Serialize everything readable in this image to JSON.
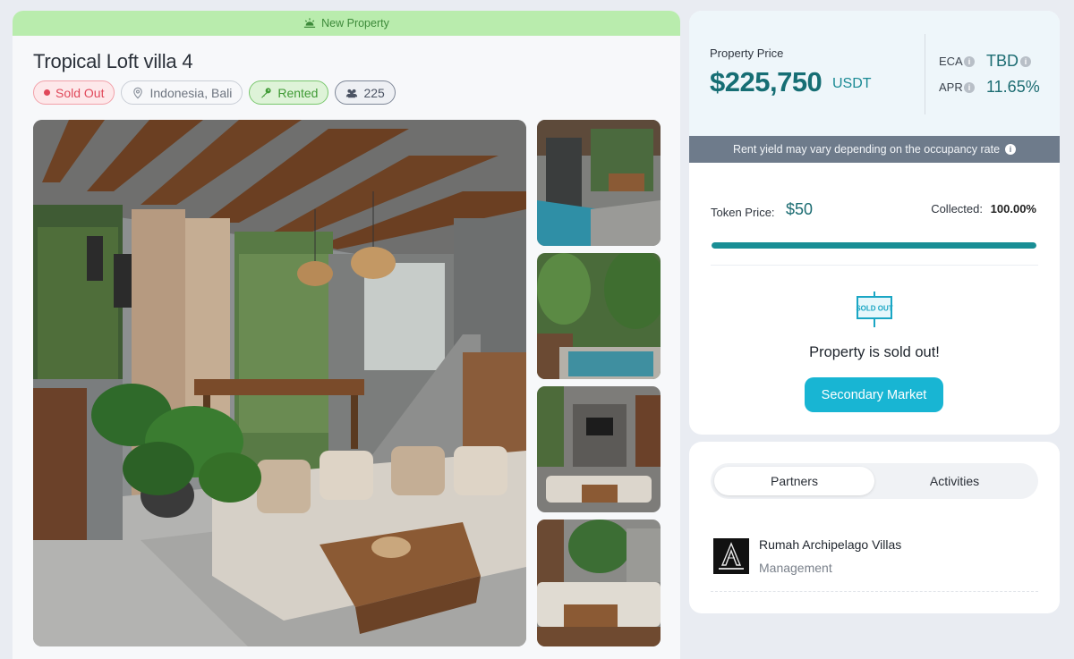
{
  "banner": {
    "label": "New Property"
  },
  "property": {
    "title": "Tropical Loft villa 4",
    "status": "Sold Out",
    "location": "Indonesia, Bali",
    "rental_status": "Rented",
    "investors": "225"
  },
  "pricing": {
    "label": "Property Price",
    "value": "$225,750",
    "unit": "USDT",
    "eca_label": "ECA",
    "eca_value": "TBD",
    "apr_label": "APR",
    "apr_value": "11.65%",
    "note": "Rent yield may vary depending on the occupancy rate"
  },
  "token": {
    "price_label": "Token Price:",
    "price_value": "$50",
    "collected_label": "Collected:",
    "collected_value": "100.00%",
    "collected_fraction": 1.0
  },
  "sold": {
    "icon_text": "SOLD OUT",
    "message": "Property is sold out!",
    "button": "Secondary Market"
  },
  "tabs": [
    {
      "label": "Partners",
      "active": true
    },
    {
      "label": "Activities",
      "active": false
    }
  ],
  "partner": {
    "name": "Rumah Archipelago Villas",
    "role": "Management"
  },
  "colors": {
    "accent": "#18b5d3",
    "teal": "#166e74",
    "sold_out_red": "#e0485a",
    "rented_green": "#3f9a35",
    "banner_green": "#b9ecad"
  }
}
